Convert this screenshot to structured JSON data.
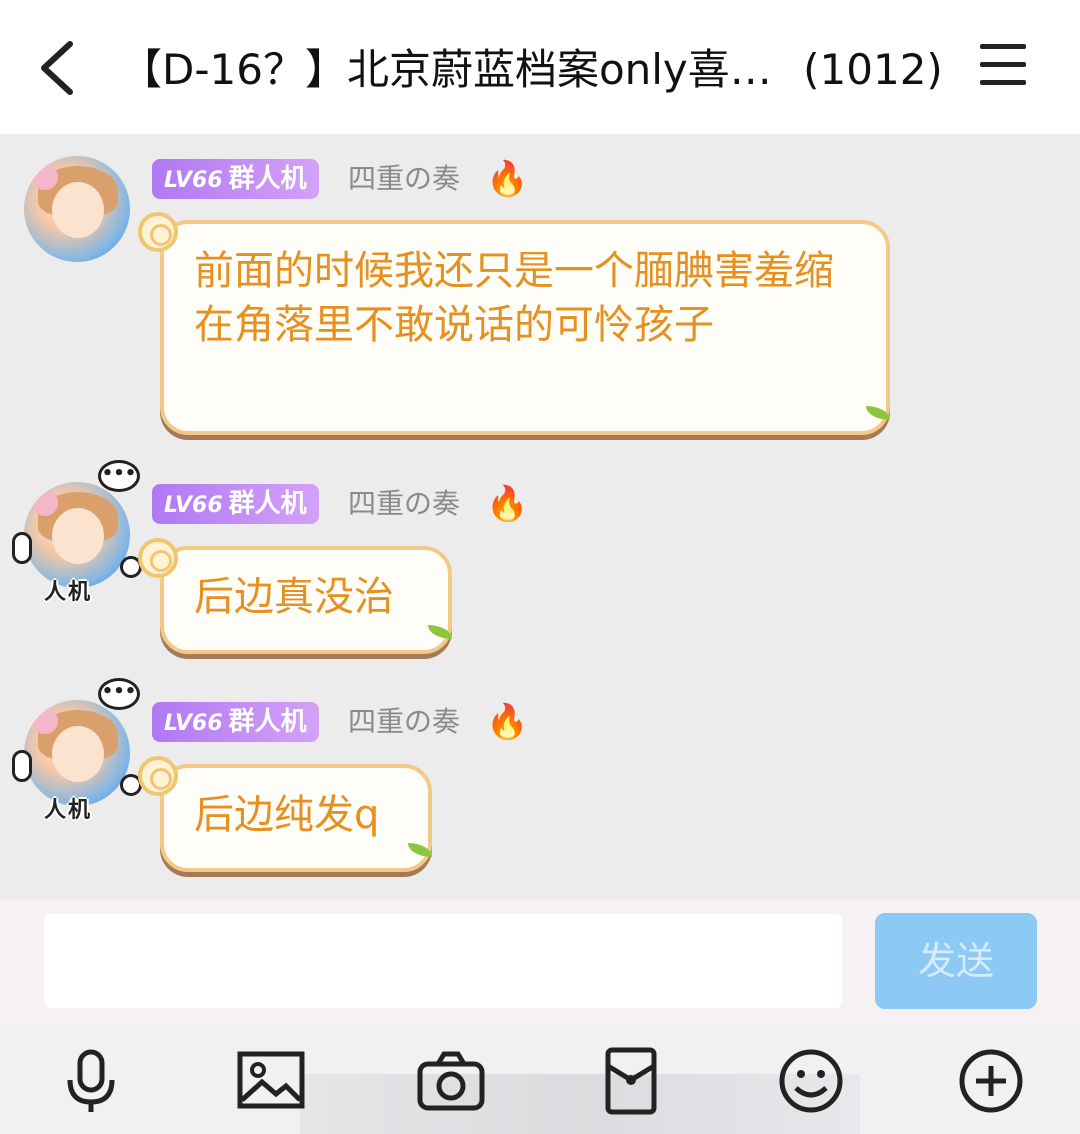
{
  "header": {
    "title": "【D-16？】北京蔚蓝档案only喜…",
    "member_count": "(1012)"
  },
  "messages": [
    {
      "level": "LV66",
      "title_badge": "群人机",
      "nickname": "四重の奏",
      "text": "前面的时候我还只是一个腼腆害羞缩在角落里不敢说话的可怜孩子",
      "avatar_frame_text": ""
    },
    {
      "level": "LV66",
      "title_badge": "群人机",
      "nickname": "四重の奏",
      "text": "后边真没治",
      "avatar_frame_text": "人机"
    },
    {
      "level": "LV66",
      "title_badge": "群人机",
      "nickname": "四重の奏",
      "text": "后边纯发q",
      "avatar_frame_text": "人机"
    }
  ],
  "input": {
    "value": "",
    "send_label": "发送"
  },
  "toolbar": {
    "items": [
      "microphone-icon",
      "image-icon",
      "camera-icon",
      "red-packet-icon",
      "emoji-icon",
      "add-icon"
    ]
  },
  "colors": {
    "bubble_text": "#e5901f",
    "bubble_border": "#f3c988",
    "badge": "#b078f4",
    "send_button": "#8cc9f5"
  }
}
